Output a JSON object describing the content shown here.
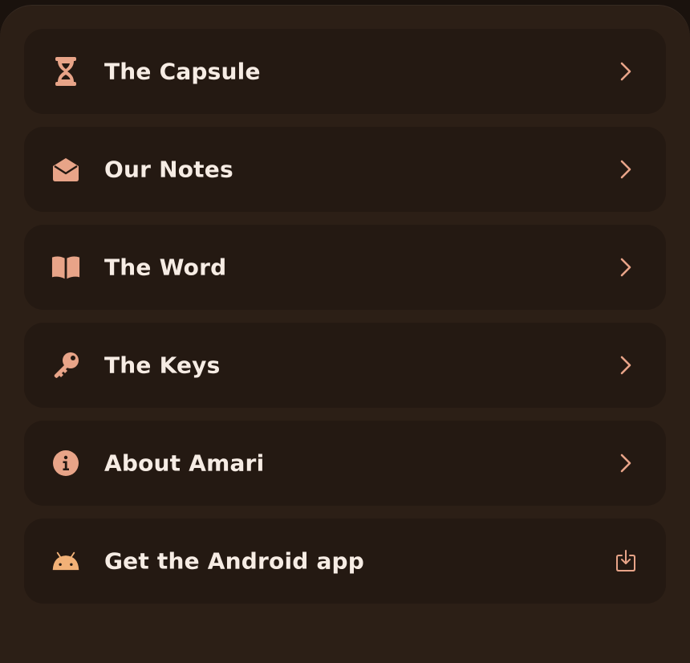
{
  "menu": {
    "items": [
      {
        "label": "The Capsule",
        "icon": "hourglass-icon",
        "trailing": "chevron-right-icon"
      },
      {
        "label": "Our Notes",
        "icon": "envelope-open-icon",
        "trailing": "chevron-right-icon"
      },
      {
        "label": "The Word",
        "icon": "book-open-icon",
        "trailing": "chevron-right-icon"
      },
      {
        "label": "The Keys",
        "icon": "key-icon",
        "trailing": "chevron-right-icon"
      },
      {
        "label": "About Amari",
        "icon": "info-icon",
        "trailing": "chevron-right-icon"
      },
      {
        "label": "Get the Android app",
        "icon": "android-icon",
        "trailing": "download-icon"
      }
    ]
  },
  "colors": {
    "sheet_background": "#2c1f16",
    "item_background": "#241912",
    "accent": "#e8a488",
    "text": "#f6ece4"
  }
}
